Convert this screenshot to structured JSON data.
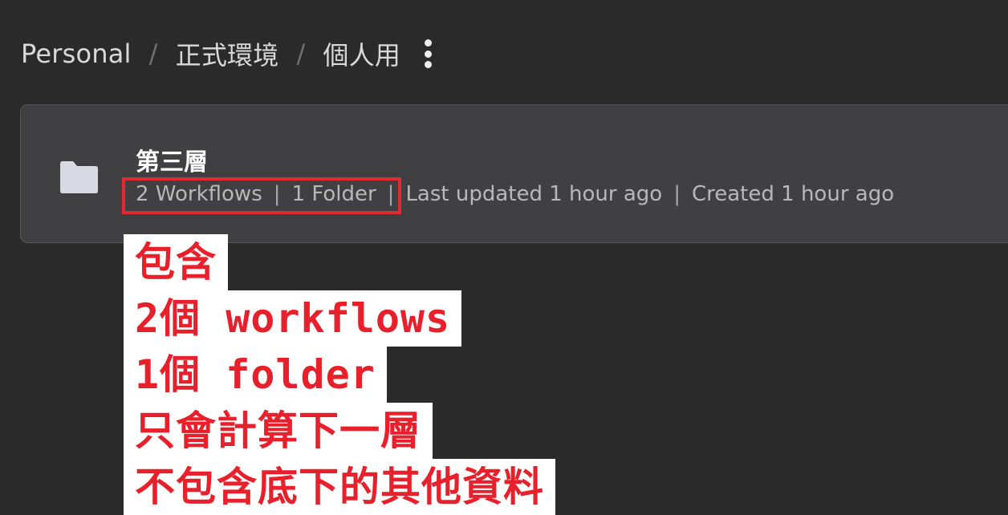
{
  "breadcrumb": {
    "items": [
      "Personal",
      "正式環境",
      "個人用"
    ],
    "separator": "/",
    "more_icon": "more-vertical-icon"
  },
  "folder": {
    "icon": "folder-icon",
    "title": "第三層",
    "workflows": "2 Workflows",
    "folders": "1 Folder",
    "last_updated": "Last updated 1 hour ago",
    "created": "Created 1 hour ago",
    "meta_separator": "|"
  },
  "annotation": {
    "lines": [
      "包含",
      "2個 workflows",
      "1個 folder",
      "只會計算下一層",
      "不包含底下的其他資料"
    ]
  },
  "colors": {
    "background": "#2a2a2a",
    "card": "#404042",
    "annotation_text": "#e8202c",
    "highlight_border": "#e02b35"
  }
}
